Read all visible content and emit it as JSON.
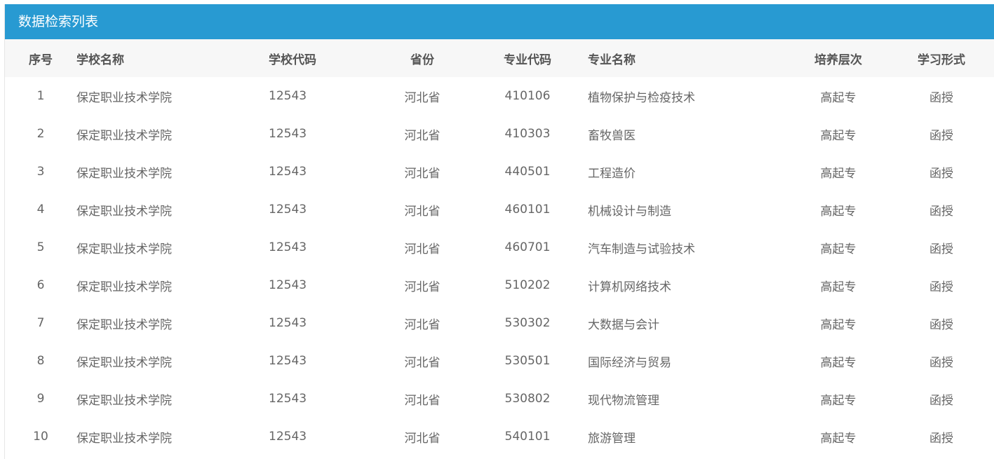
{
  "panel": {
    "title": "数据检索列表"
  },
  "columns": {
    "index": "序号",
    "school_name": "学校名称",
    "school_code": "学校代码",
    "province": "省份",
    "major_code": "专业代码",
    "major_name": "专业名称",
    "level": "培养层次",
    "mode": "学习形式"
  },
  "rows": [
    {
      "index": "1",
      "school_name": "保定职业技术学院",
      "school_code": "12543",
      "province": "河北省",
      "major_code": "410106",
      "major_name": "植物保护与检疫技术",
      "level": "高起专",
      "mode": "函授"
    },
    {
      "index": "2",
      "school_name": "保定职业技术学院",
      "school_code": "12543",
      "province": "河北省",
      "major_code": "410303",
      "major_name": "畜牧兽医",
      "level": "高起专",
      "mode": "函授"
    },
    {
      "index": "3",
      "school_name": "保定职业技术学院",
      "school_code": "12543",
      "province": "河北省",
      "major_code": "440501",
      "major_name": "工程造价",
      "level": "高起专",
      "mode": "函授"
    },
    {
      "index": "4",
      "school_name": "保定职业技术学院",
      "school_code": "12543",
      "province": "河北省",
      "major_code": "460101",
      "major_name": "机械设计与制造",
      "level": "高起专",
      "mode": "函授"
    },
    {
      "index": "5",
      "school_name": "保定职业技术学院",
      "school_code": "12543",
      "province": "河北省",
      "major_code": "460701",
      "major_name": "汽车制造与试验技术",
      "level": "高起专",
      "mode": "函授"
    },
    {
      "index": "6",
      "school_name": "保定职业技术学院",
      "school_code": "12543",
      "province": "河北省",
      "major_code": "510202",
      "major_name": "计算机网络技术",
      "level": "高起专",
      "mode": "函授"
    },
    {
      "index": "7",
      "school_name": "保定职业技术学院",
      "school_code": "12543",
      "province": "河北省",
      "major_code": "530302",
      "major_name": "大数据与会计",
      "level": "高起专",
      "mode": "函授"
    },
    {
      "index": "8",
      "school_name": "保定职业技术学院",
      "school_code": "12543",
      "province": "河北省",
      "major_code": "530501",
      "major_name": "国际经济与贸易",
      "level": "高起专",
      "mode": "函授"
    },
    {
      "index": "9",
      "school_name": "保定职业技术学院",
      "school_code": "12543",
      "province": "河北省",
      "major_code": "530802",
      "major_name": "现代物流管理",
      "level": "高起专",
      "mode": "函授"
    },
    {
      "index": "10",
      "school_name": "保定职业技术学院",
      "school_code": "12543",
      "province": "河北省",
      "major_code": "540101",
      "major_name": "旅游管理",
      "level": "高起专",
      "mode": "函授"
    }
  ],
  "colors": {
    "header_bar": "#289ad2",
    "table_head_bg": "#f7f7f7",
    "cell_text": "#666666"
  }
}
